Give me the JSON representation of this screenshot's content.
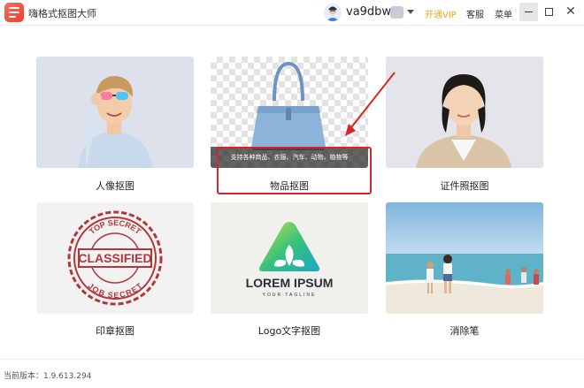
{
  "app": {
    "title": "嗨格式抠图大师"
  },
  "user": {
    "name": "va9dbw9"
  },
  "header": {
    "open_vip": "开通VIP",
    "service": "客服",
    "menu": "菜单"
  },
  "window_controls": {
    "minimize": "—",
    "close": "✕"
  },
  "tiles": [
    {
      "label": "人像抠图"
    },
    {
      "label": "物品抠图",
      "caption": "支持各种商品、衣服、汽车、动物、植物等"
    },
    {
      "label": "证件照抠图"
    },
    {
      "label": "印章抠图",
      "stamp": {
        "top": "TOP SECRET",
        "middle": "CLASSIFIED",
        "bottom": "JOB SECRET"
      }
    },
    {
      "label": "Logo文字抠图",
      "logo": {
        "name": "LOREM IPSUM",
        "tagline": "YOUR TAGLINE"
      }
    },
    {
      "label": "消除笔"
    }
  ],
  "colors": {
    "vip": "#e5a81f",
    "highlight": "#d6262a",
    "brand": "#e8412f"
  },
  "footer": {
    "version": "当前版本：1.9.613.294"
  }
}
